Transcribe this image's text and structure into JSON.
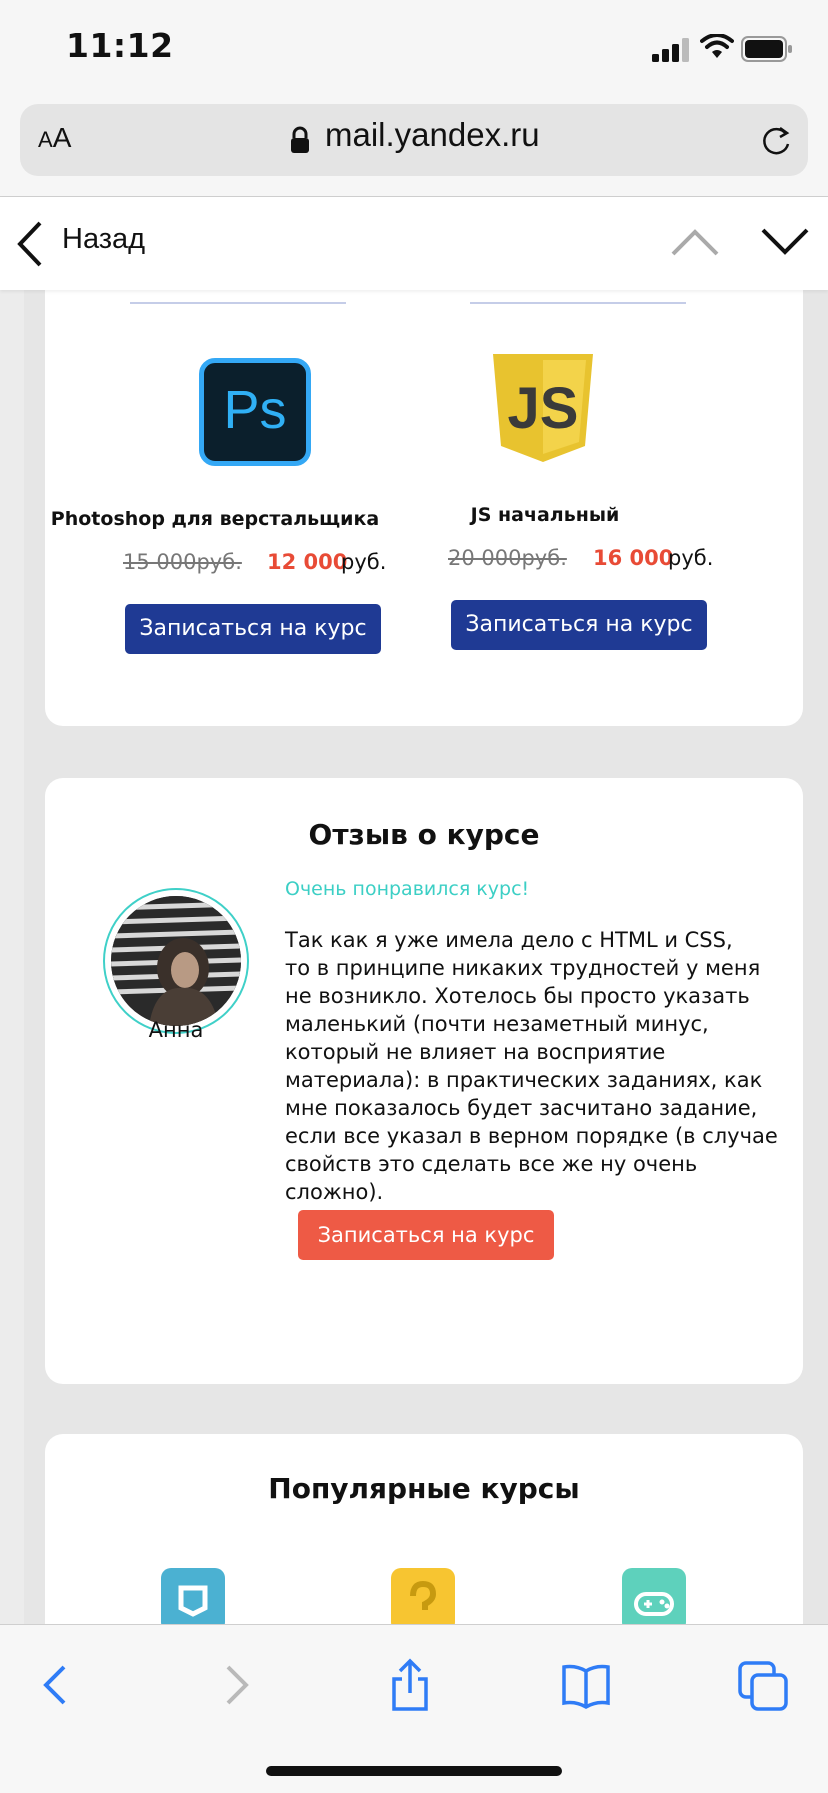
{
  "status": {
    "time": "11:12"
  },
  "browser": {
    "text_size_small": "A",
    "text_size_large": "A",
    "url": "mail.yandex.ru"
  },
  "nav": {
    "back_label": "Назад"
  },
  "courses": [
    {
      "title": "Photoshop для верстальщика",
      "old_price": "15 000руб.",
      "new_price": "12 000",
      "currency": "руб.",
      "button": "Записаться на курс",
      "logo_text": "Ps"
    },
    {
      "title": "JS начальный",
      "old_price": "20 000руб.",
      "new_price": "16 000",
      "currency": "руб.",
      "button": "Записаться на курс",
      "logo_text": "JS"
    }
  ],
  "review": {
    "title": "Отзыв о курсе",
    "name": "Анна",
    "headline": "Очень понравился курс!",
    "lines": [
      "Так как я уже имела дело с HTML и CSS,",
      "то в принципе никаких трудностей у меня",
      "не возникло. Хотелось бы просто указать",
      "маленький (почти незаметный минус,",
      "который не влияет на восприятие",
      "материала): в практических заданиях, как",
      "мне показалось будет засчитано задание,",
      "если все указал в верном порядке (в случае",
      "свойств это сделать все же ну очень",
      "сложно)."
    ],
    "button": "Записаться на курс"
  },
  "popular": {
    "title": "Популярные курсы"
  },
  "colors": {
    "accent_blue": "#1f3a94",
    "accent_red": "#ee5a45",
    "teal": "#3ccfc5",
    "price_red": "#e84b36",
    "ios_blue": "#2f7cf6"
  }
}
